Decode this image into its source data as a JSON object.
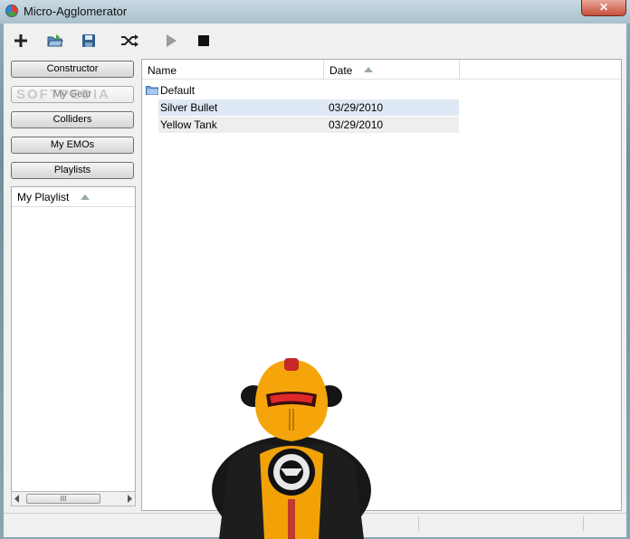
{
  "window": {
    "title": "Micro-Agglomerator",
    "close_label": "✕"
  },
  "toolbar": {
    "icons": [
      "plus-icon",
      "open-folder-icon",
      "save-icon",
      "shuffle-icon",
      "play-icon",
      "stop-icon"
    ]
  },
  "sidebar": {
    "buttons": [
      {
        "label": "Constructor",
        "enabled": true
      },
      {
        "label": "My Gear",
        "enabled": false
      },
      {
        "label": "Colliders",
        "enabled": true
      },
      {
        "label": "My EMOs",
        "enabled": true
      },
      {
        "label": "Playlists",
        "enabled": true
      }
    ],
    "playlist_header": "My Playlist",
    "scroll_grip": "III"
  },
  "list": {
    "columns": [
      {
        "label": "Name"
      },
      {
        "label": "Date"
      }
    ],
    "group": "Default",
    "rows": [
      {
        "name": "Silver Bullet",
        "date": "03/29/2010"
      },
      {
        "name": "Yellow Tank",
        "date": "03/29/2010"
      }
    ]
  },
  "watermark": "SOFTPEDIA",
  "colors": {
    "selected_row": "#dfe9f5",
    "window_frame": "#8fb0bf",
    "robot_body": "#f5a50a"
  }
}
